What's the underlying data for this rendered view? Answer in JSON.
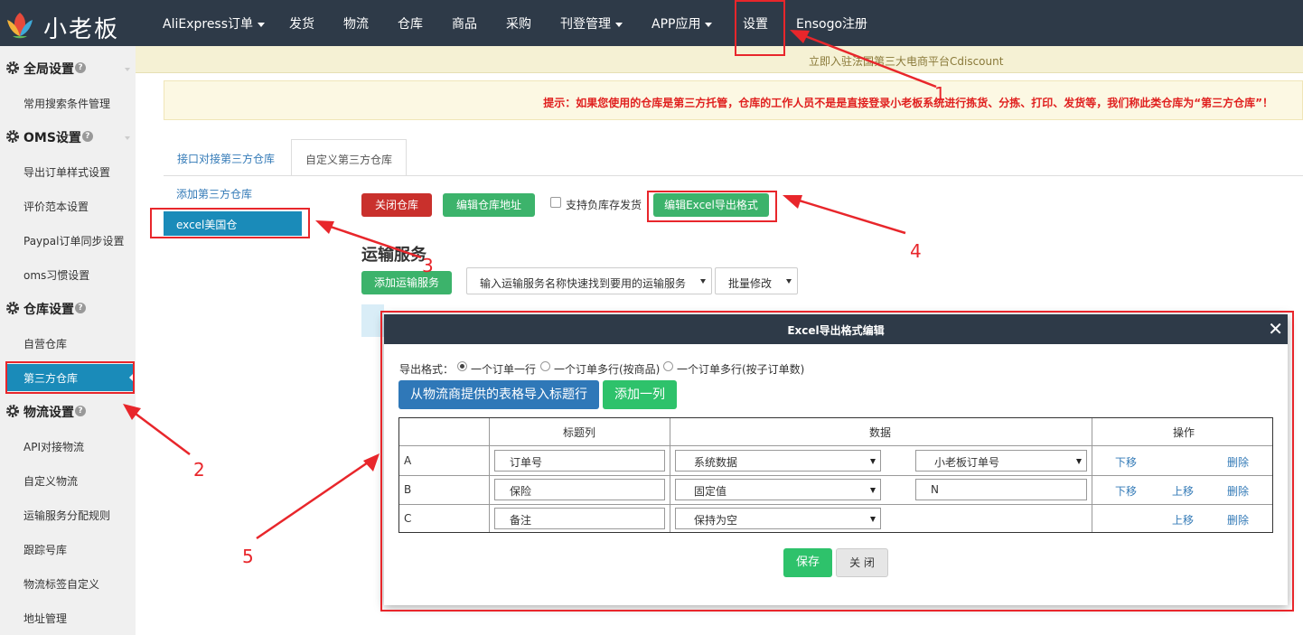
{
  "app": {
    "logo_text": "小老板"
  },
  "nav": {
    "items": [
      {
        "label": "AliExpress订单",
        "dropdown": true
      },
      {
        "label": "发货",
        "dropdown": false
      },
      {
        "label": "物流",
        "dropdown": false
      },
      {
        "label": "仓库",
        "dropdown": false
      },
      {
        "label": "商品",
        "dropdown": false
      },
      {
        "label": "采购",
        "dropdown": false
      },
      {
        "label": "刊登管理",
        "dropdown": true
      },
      {
        "label": "APP应用",
        "dropdown": true
      },
      {
        "label": "设置",
        "dropdown": false
      },
      {
        "label": "Ensogo注册",
        "dropdown": false
      }
    ]
  },
  "banner": {
    "text": "立即入驻法国第三大电商平台Cdiscount"
  },
  "tip": {
    "text": "提示：如果您使用的仓库是第三方托管，仓库的工作人员不是是直接登录小老板系统进行拣货、分拣、打印、发货等，我们称此类仓库为“第三方仓库”！"
  },
  "sidebar": {
    "sections": [
      {
        "title": "全局设置",
        "items": [
          "常用搜索条件管理"
        ]
      },
      {
        "title": "OMS设置",
        "items": [
          "导出订单样式设置",
          "评价范本设置",
          "Paypal订单同步设置",
          "oms习惯设置"
        ]
      },
      {
        "title": "仓库设置",
        "items": [
          "自营仓库",
          "第三方仓库"
        ]
      },
      {
        "title": "物流设置",
        "items": [
          "API对接物流",
          "自定义物流",
          "运输服务分配规则",
          "跟踪号库",
          "物流标签自定义",
          "地址管理"
        ]
      }
    ],
    "help_glyph": "?"
  },
  "tabs": [
    {
      "label": "接口对接第三方仓库",
      "active": false
    },
    {
      "label": "自定义第三方仓库",
      "active": true
    }
  ],
  "warehouse": {
    "add_link": "添加第三方仓库",
    "selected": "excel美国仓"
  },
  "actions": {
    "close_wh": "关闭仓库",
    "edit_addr": "编辑仓库地址",
    "negative_stock": "支持负库存发货",
    "edit_excel": "编辑Excel导出格式"
  },
  "shipping": {
    "title": "运输服务",
    "add_btn": "添加运输服务",
    "search_select": "输入运输服务名称快速找到要用的运输服务",
    "bulk_select": "批量修改"
  },
  "modal": {
    "title": "Excel导出格式编辑",
    "close_glyph": "✕",
    "format_label": "导出格式：",
    "formats": [
      {
        "label": "一个订单一行",
        "checked": true
      },
      {
        "label": "一个订单多行(按商品)",
        "checked": false
      },
      {
        "label": "一个订单多行(按子订单数)",
        "checked": false
      }
    ],
    "import_btn": "从物流商提供的表格导入标题行",
    "add_col_btn": "添加一列",
    "table": {
      "headers": [
        "",
        "标题列",
        "数据",
        "操作"
      ],
      "rows": [
        {
          "col": "A",
          "title": "订单号",
          "data_type": "系统数据",
          "data_value": "小老板订单号",
          "value_kind": "select",
          "down": "下移",
          "up": "",
          "del": "删除"
        },
        {
          "col": "B",
          "title": "保险",
          "data_type": "固定值",
          "data_value": "N",
          "value_kind": "input",
          "down": "下移",
          "up": "上移",
          "del": "删除"
        },
        {
          "col": "C",
          "title": "备注",
          "data_type": "保持为空",
          "data_value": "",
          "value_kind": "none",
          "down": "",
          "up": "上移",
          "del": "删除"
        }
      ]
    },
    "save_btn": "保存",
    "close_btn": "关 闭"
  },
  "annotations": {
    "labels": [
      "1",
      "2",
      "3",
      "4",
      "5"
    ],
    "color": "#e8262b"
  },
  "colors": {
    "nav_bg": "#2e3a48",
    "accent_blue": "#1a8bb9",
    "green": "#3cb36b",
    "red": "#c9302c",
    "link": "#337ab7"
  }
}
